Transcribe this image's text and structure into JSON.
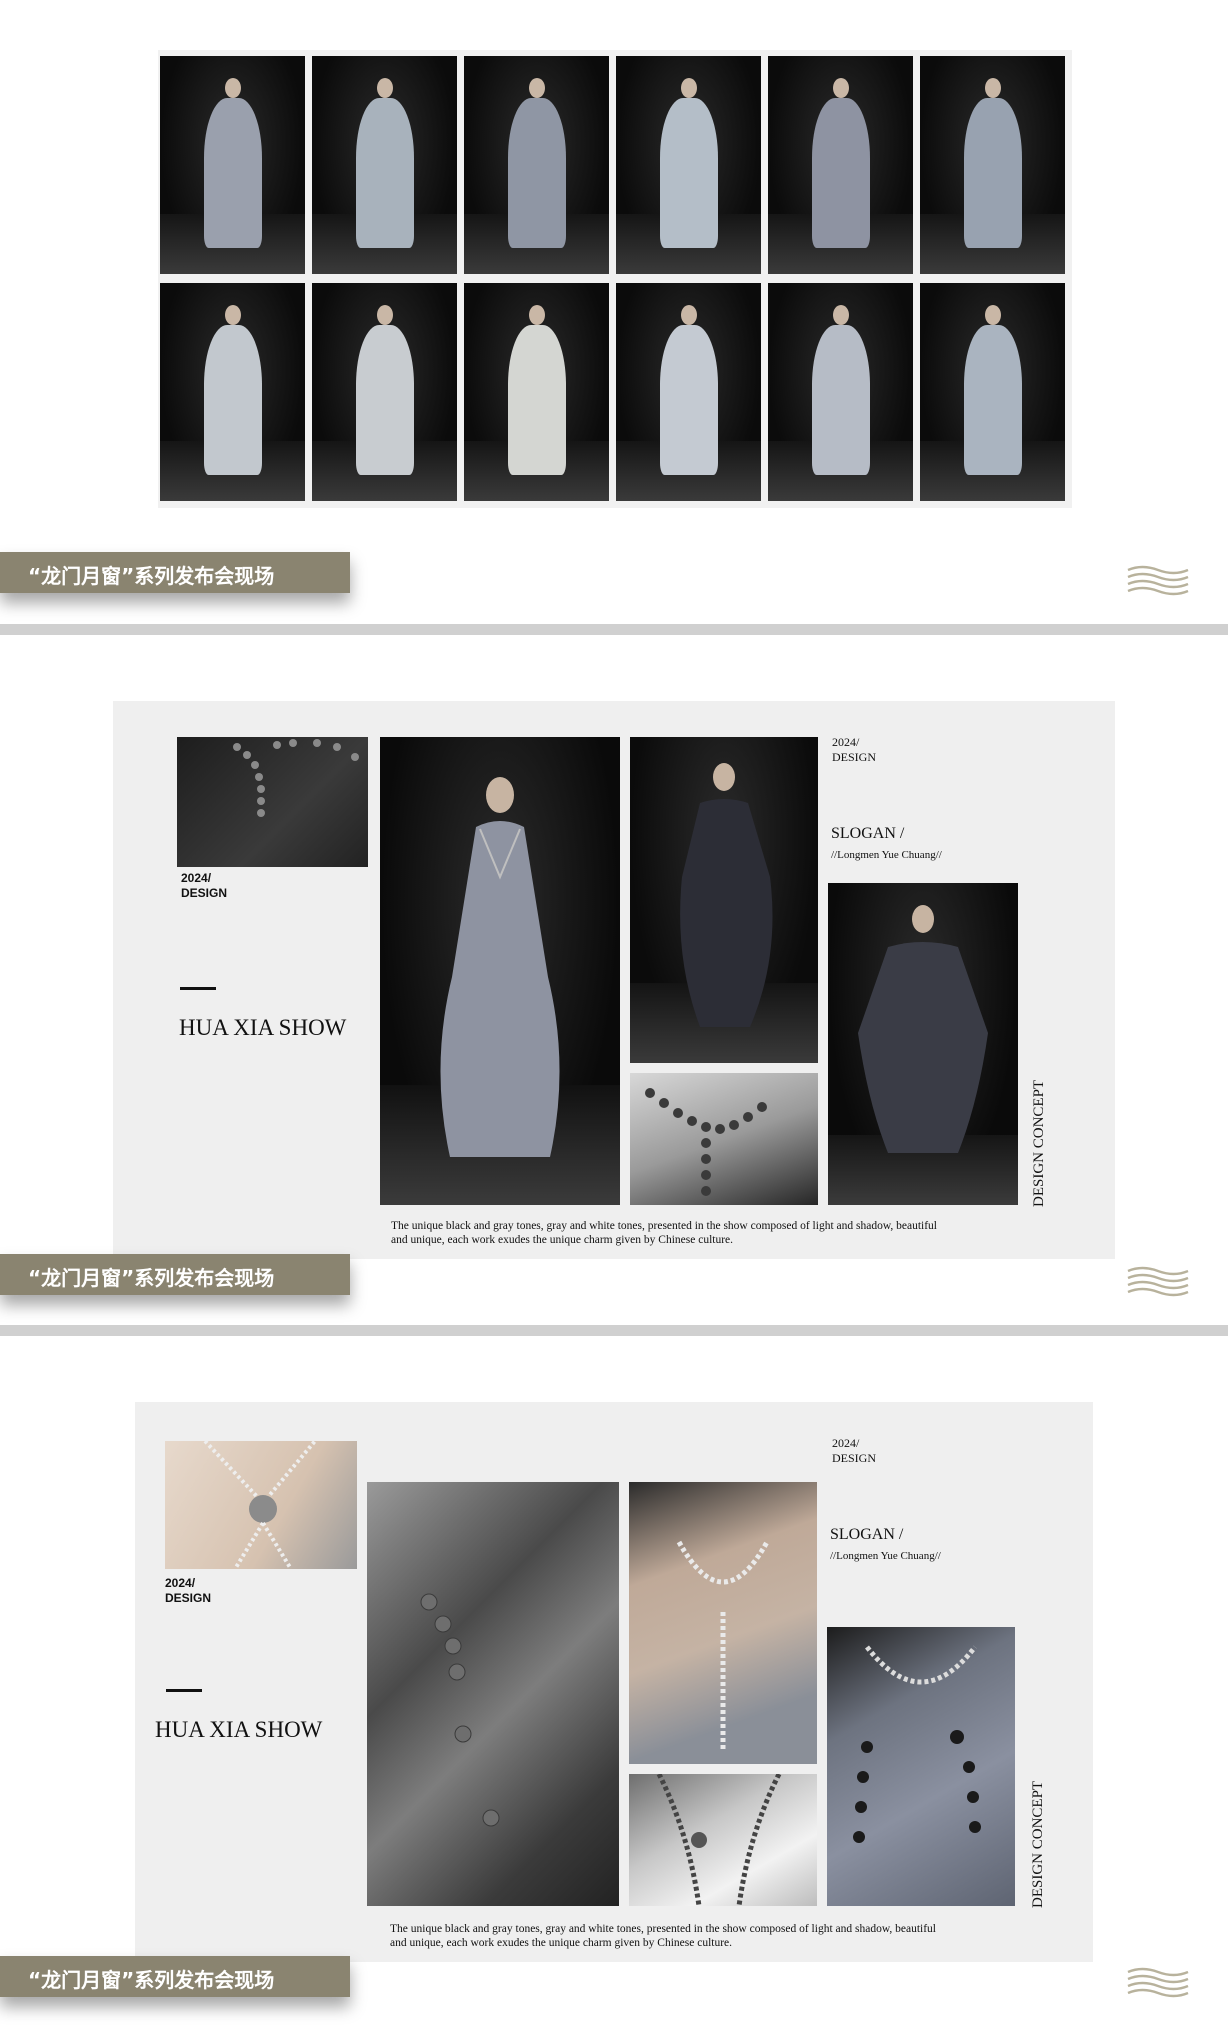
{
  "label": "“龙门月窗”系列发布会现场",
  "runway_grid": {
    "looks": [
      {
        "tone": "#9aa0ad"
      },
      {
        "tone": "#a8b2bc"
      },
      {
        "tone": "#8f96a4"
      },
      {
        "tone": "#b4bec8"
      },
      {
        "tone": "#8e93a2"
      },
      {
        "tone": "#98a2b0"
      },
      {
        "tone": "#c2c8ce"
      },
      {
        "tone": "#c8ccd0"
      },
      {
        "tone": "#d4d6d2"
      },
      {
        "tone": "#c4cad2"
      },
      {
        "tone": "#b6bcc6"
      },
      {
        "tone": "#aab4c0"
      }
    ]
  },
  "slides": [
    {
      "design_top": "2024/\nDESIGN",
      "design_left": "2024/\nDESIGN",
      "slogan": "SLOGAN /",
      "slogan_sub": "//Longmen Yue Chuang//",
      "title": "HUA XIA SHOW",
      "concept": "DESIGN CONCEPT",
      "caption": "The unique black and gray tones, gray and white tones, presented in the show composed of light and shadow, beautiful and unique, each work exudes the unique charm given by Chinese culture."
    },
    {
      "design_top": "2024/\nDESIGN",
      "design_left": "2024/\nDESIGN",
      "slogan": "SLOGAN /",
      "slogan_sub": "//Longmen Yue Chuang//",
      "title": "HUA XIA SHOW",
      "concept": "DESIGN CONCEPT",
      "caption": "The unique black and gray tones, gray and white tones, presented in the show composed of light and shadow, beautiful and unique, each work exudes the unique charm given by Chinese culture."
    }
  ],
  "colors": {
    "label_bar": "#8a8470",
    "panel": "#efefef",
    "separator": "#d0d0d0",
    "wave": "#b8b29c"
  }
}
